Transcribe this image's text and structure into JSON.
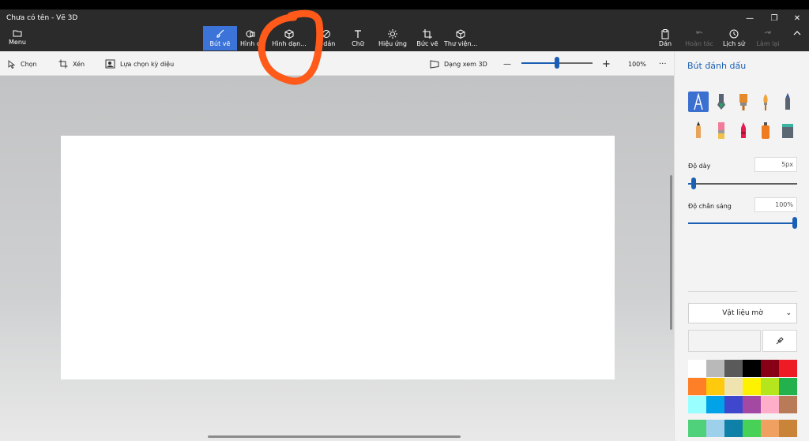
{
  "window": {
    "title": "Chưa có tên - Vẽ 3D",
    "minimize": "—",
    "maximize": "❐",
    "close": "✕"
  },
  "ribbon": {
    "menu_label": "Menu",
    "tools": [
      {
        "label": "Bút vẽ",
        "icon": "brush-icon"
      },
      {
        "label": "Hình d",
        "icon": "shapes-2d-icon"
      },
      {
        "label": "Hình dạn...",
        "icon": "cube-icon"
      },
      {
        "label": "h dán",
        "icon": "sticker-icon"
      },
      {
        "label": "Chữ",
        "icon": "text-icon"
      },
      {
        "label": "Hiệu ứng",
        "icon": "effects-icon"
      },
      {
        "label": "Bức vẽ",
        "icon": "canvas-icon"
      },
      {
        "label": "Thư viện...",
        "icon": "library-icon"
      }
    ],
    "right": [
      {
        "label": "Dán",
        "icon": "paste-icon"
      },
      {
        "label": "Hoàn tác",
        "icon": "undo-icon"
      },
      {
        "label": "Lịch sử",
        "icon": "history-icon"
      },
      {
        "label": "Làm lại",
        "icon": "redo-icon"
      }
    ]
  },
  "toolbar": {
    "select": "Chọn",
    "crop": "Xén",
    "magic_select": "Lựa chọn kỳ diệu",
    "view_3d": "Dạng xem 3D",
    "zoom_minus": "—",
    "zoom_plus": "+",
    "zoom_level": "100%",
    "zoom_fraction": 0.5,
    "more": "···"
  },
  "panel": {
    "title": "Bút đánh dấu",
    "thickness_label": "Độ dày",
    "thickness_value": "5px",
    "thickness_fraction": 0.05,
    "opacity_label": "Độ chắn sáng",
    "opacity_value": "100%",
    "opacity_fraction": 1.0,
    "material": "Vật liệu mờ",
    "material_chevron": "⌄",
    "colors": [
      [
        "#ffffff",
        "#b9b9b9",
        "#5a5a5a",
        "#000000",
        "#880015",
        "#ed1c24"
      ],
      [
        "#ff7f27",
        "#ffc90e",
        "#efe4b0",
        "#fff200",
        "#b5e61d",
        "#22b14c"
      ],
      [
        "#99ffff",
        "#00a2e8",
        "#3f48cc",
        "#a349a4",
        "#ffaec9",
        "#b97a57"
      ],
      [
        "#4fd17b",
        "#9dd0ea",
        "#0f80a8",
        "#47d257",
        "#f0a060",
        "#c9843a"
      ]
    ]
  },
  "accent": "#3c73d8",
  "annotation_color": "#ff5a1a"
}
